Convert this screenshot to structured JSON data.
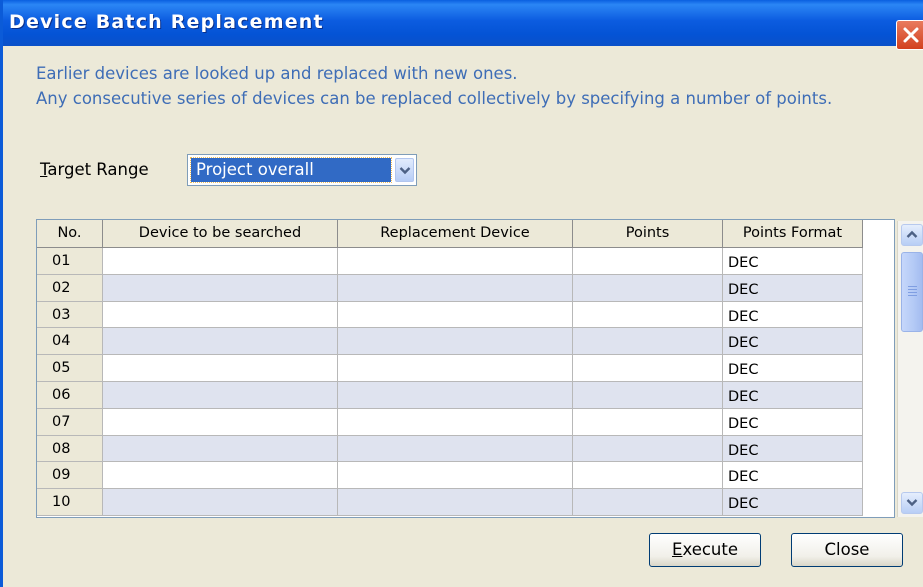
{
  "window": {
    "title": "Device Batch Replacement"
  },
  "description": {
    "line1": "Earlier devices are looked up and replaced with new ones.",
    "line2": "Any consecutive series of devices can be replaced collectively by specifying a number of points."
  },
  "target_range": {
    "label_underlined": "T",
    "label_rest": "arget Range",
    "selected": "Project overall"
  },
  "table": {
    "columns": [
      "No.",
      "Device to be searched",
      "Replacement Device",
      "Points",
      "Points Format"
    ],
    "rows": [
      {
        "no": "01",
        "device": "",
        "replacement": "",
        "points": "",
        "format": "DEC"
      },
      {
        "no": "02",
        "device": "",
        "replacement": "",
        "points": "",
        "format": "DEC"
      },
      {
        "no": "03",
        "device": "",
        "replacement": "",
        "points": "",
        "format": "DEC"
      },
      {
        "no": "04",
        "device": "",
        "replacement": "",
        "points": "",
        "format": "DEC"
      },
      {
        "no": "05",
        "device": "",
        "replacement": "",
        "points": "",
        "format": "DEC"
      },
      {
        "no": "06",
        "device": "",
        "replacement": "",
        "points": "",
        "format": "DEC"
      },
      {
        "no": "07",
        "device": "",
        "replacement": "",
        "points": "",
        "format": "DEC"
      },
      {
        "no": "08",
        "device": "",
        "replacement": "",
        "points": "",
        "format": "DEC"
      },
      {
        "no": "09",
        "device": "",
        "replacement": "",
        "points": "",
        "format": "DEC"
      },
      {
        "no": "10",
        "device": "",
        "replacement": "",
        "points": "",
        "format": "DEC"
      }
    ]
  },
  "buttons": {
    "execute_underlined": "E",
    "execute_rest": "xecute",
    "close": "Close"
  },
  "colors": {
    "title_bar": "#0453d5",
    "description_text": "#3e6db6",
    "selection": "#316ac5",
    "row_alt": "#dfe3ef"
  }
}
